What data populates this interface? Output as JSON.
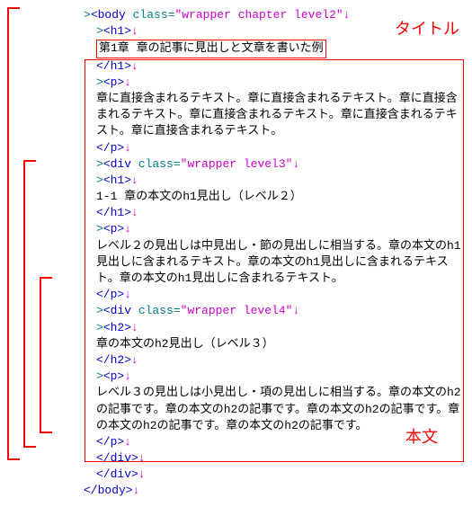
{
  "annotations": {
    "title": "タイトル",
    "body": "本文"
  },
  "lines": {
    "body_open": {
      "tag_open": "<body ",
      "attr": "class=",
      "val": "\"wrapper chapter level2\"",
      "tag_close": ""
    },
    "h1_open": "<h1>",
    "h1_text": "第1章 章の記事に見出しと文章を書いた例",
    "h1_close": "</h1>",
    "p_open": "<p>",
    "p_close": "</p>",
    "para1": "章に直接含まれるテキスト。章に直接含まれるテキスト。章に直接含まれるテキスト。章に直接含まれるテキスト。章に直接含まれるテキスト。章に直接含まれるテキスト。",
    "div3": {
      "tag_open": "<div ",
      "attr": "class=",
      "val": "\"wrapper level3\"",
      "tag_close": ""
    },
    "h1b_open": "<h1>",
    "h1b_text": "1-1 章の本文のh1見出し（レベル２）",
    "h1b_close": "</h1>",
    "para2": "レベル２の見出しは中見出し・節の見出しに相当する。章の本文のh1見出しに含まれるテキスト。章の本文のh1見出しに含まれるテキスト。章の本文のh1見出しに含まれるテキスト。",
    "div4": {
      "tag_open": "<div ",
      "attr": "class=",
      "val": "\"wrapper level4\"",
      "tag_close": ""
    },
    "h2_open": "<h2>",
    "h2_text": "章の本文のh2見出し（レベル３）",
    "h2_close": "</h2>",
    "para3": "レベル３の見出しは小見出し・項の見出しに相当する。章の本文のh2の記事です。章の本文のh2の記事です。章の本文のh2の記事です。章の本文のh2の記事です。章の本文のh2の記事です。",
    "div_close": "</div>",
    "body_close": "</body>"
  },
  "symbols": {
    "gt": ">",
    "para": "↓"
  }
}
